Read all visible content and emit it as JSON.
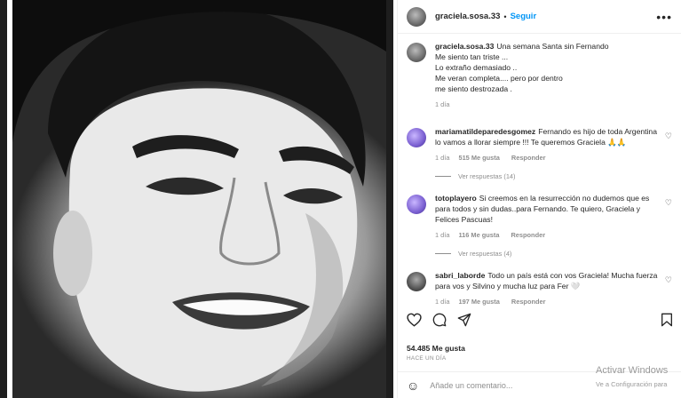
{
  "post": {
    "username": "graciela.sosa.33",
    "separator": "•",
    "follow_label": "Seguir",
    "more_label": "•••",
    "caption_user": "graciela.sosa.33",
    "caption_text": "Una semana Santa sin Fernando\nMe siento tan triste ...\nLo extraño demasiado ..\nMe veran completa.... pero por dentro\nme siento destrozada .",
    "caption_time": "1 día"
  },
  "comments": [
    {
      "user": "mariamatildeparedesgomez",
      "text": "Fernando es hijo de toda Argentina lo vamos a llorar siempre !!! Te queremos Graciela 🙏🙏",
      "time": "1 día",
      "likes": "515 Me gusta",
      "reply": "Responder",
      "view_replies": "Ver respuestas (14)",
      "avatar_style": "purple"
    },
    {
      "user": "totoplayero",
      "text": "Si creemos en la resurrección no dudemos que es para todos y sin dudas..para Fernando. Te quiero, Graciela y Felices Pascuas!",
      "time": "1 día",
      "likes": "116 Me gusta",
      "reply": "Responder",
      "view_replies": "Ver respuestas (4)",
      "avatar_style": "purple"
    },
    {
      "user": "sabri_laborde",
      "text": "Todo un país está con vos Graciela! Mucha fuerza para vos y Silvino y mucha luz para Fer 🤍",
      "time": "1 día",
      "likes": "197 Me gusta",
      "reply": "Responder",
      "avatar_style": "dark"
    }
  ],
  "footer": {
    "likes": "54.485 Me gusta",
    "ago": "HACE UN DÍA",
    "add_comment_placeholder": "Añade un comentario..."
  },
  "icons": [
    "heart-icon",
    "comment-icon",
    "share-icon",
    "bookmark-icon",
    "emoji-icon",
    "more-icon"
  ],
  "watermark": {
    "line1": "Activar Windows",
    "line2": "Ve a Configuración para"
  },
  "colors": {
    "link": "#0095f6",
    "muted": "#8e8e8e",
    "text": "#262626"
  }
}
